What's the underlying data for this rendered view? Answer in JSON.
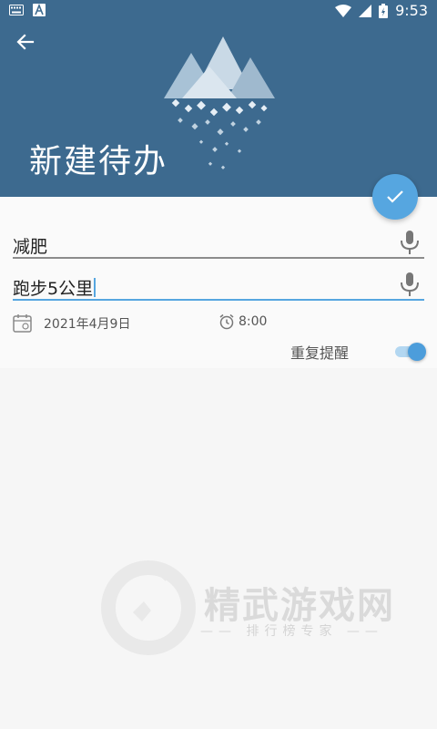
{
  "status_bar": {
    "time": "9:53"
  },
  "header": {
    "title": "新建待办"
  },
  "form": {
    "title_value": "减肥",
    "content_value": "跑步5公里",
    "date": "2021年4月9日",
    "time": "8:00",
    "repeat_label": "重复提醒",
    "repeat_enabled": true
  },
  "watermark": {
    "title": "精武游戏网",
    "subtitle": "排行榜专家"
  },
  "colors": {
    "header_bg": "#3d6a8f",
    "accent": "#56a6e0"
  }
}
